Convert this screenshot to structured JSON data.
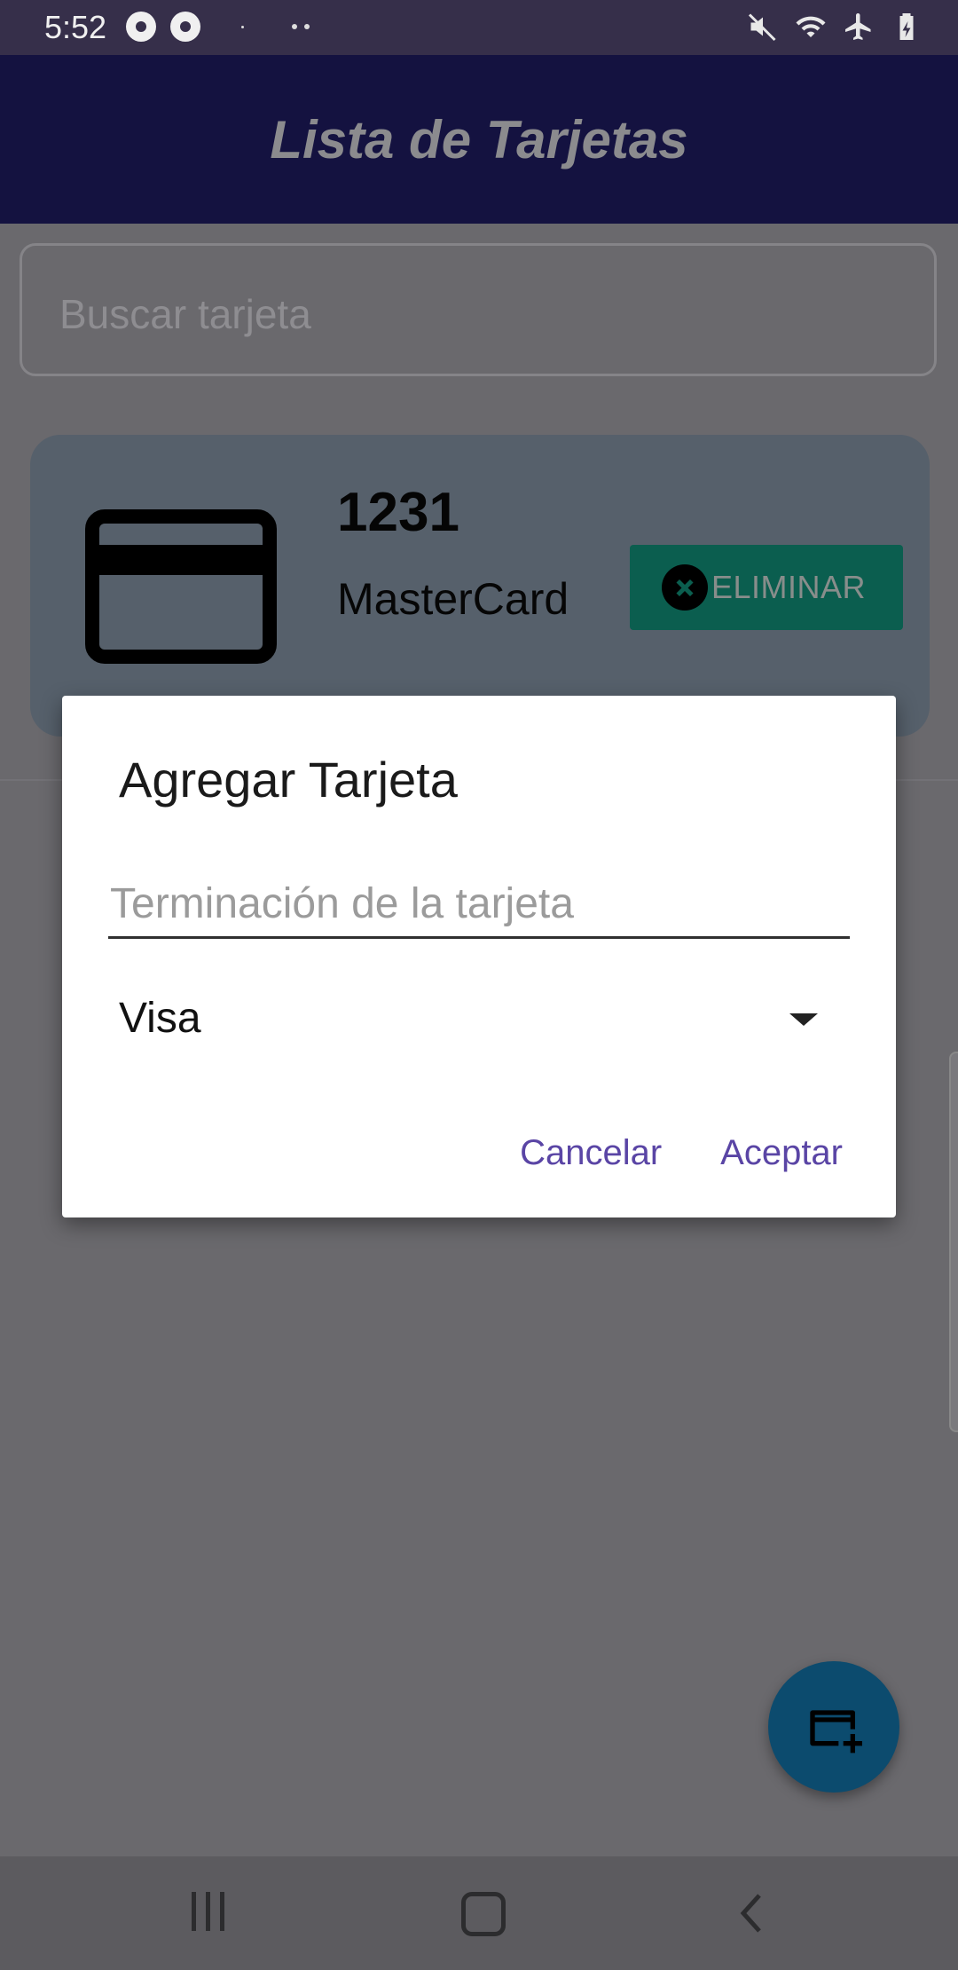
{
  "status_bar": {
    "time": "5:52",
    "icons": [
      "pokeball-icon",
      "pokeball-icon",
      "dot-icon",
      "more-dots-icon",
      "mute-icon",
      "wifi-icon",
      "airplane-icon",
      "battery-charging-icon"
    ]
  },
  "app_bar": {
    "title": "Lista de Tarjetas"
  },
  "search": {
    "placeholder": "Buscar tarjeta"
  },
  "cards": [
    {
      "number": "1231",
      "brand": "MasterCard",
      "delete_label": "ELIMINAR"
    }
  ],
  "dialog": {
    "title": "Agregar Tarjeta",
    "input_placeholder": "Terminación de la tarjeta",
    "input_value": "",
    "selected_type": "Visa",
    "cancel_label": "Cancelar",
    "accept_label": "Aceptar"
  },
  "fab": {
    "icon": "add-card-icon"
  },
  "nav_bar": {
    "icons": [
      "recent-apps-icon",
      "home-icon",
      "back-icon"
    ]
  },
  "colors": {
    "app_bar": "#141240",
    "dialog_accent": "#5a45a5",
    "delete_button": "#0b5e4f",
    "fab": "#0c4b6e"
  }
}
